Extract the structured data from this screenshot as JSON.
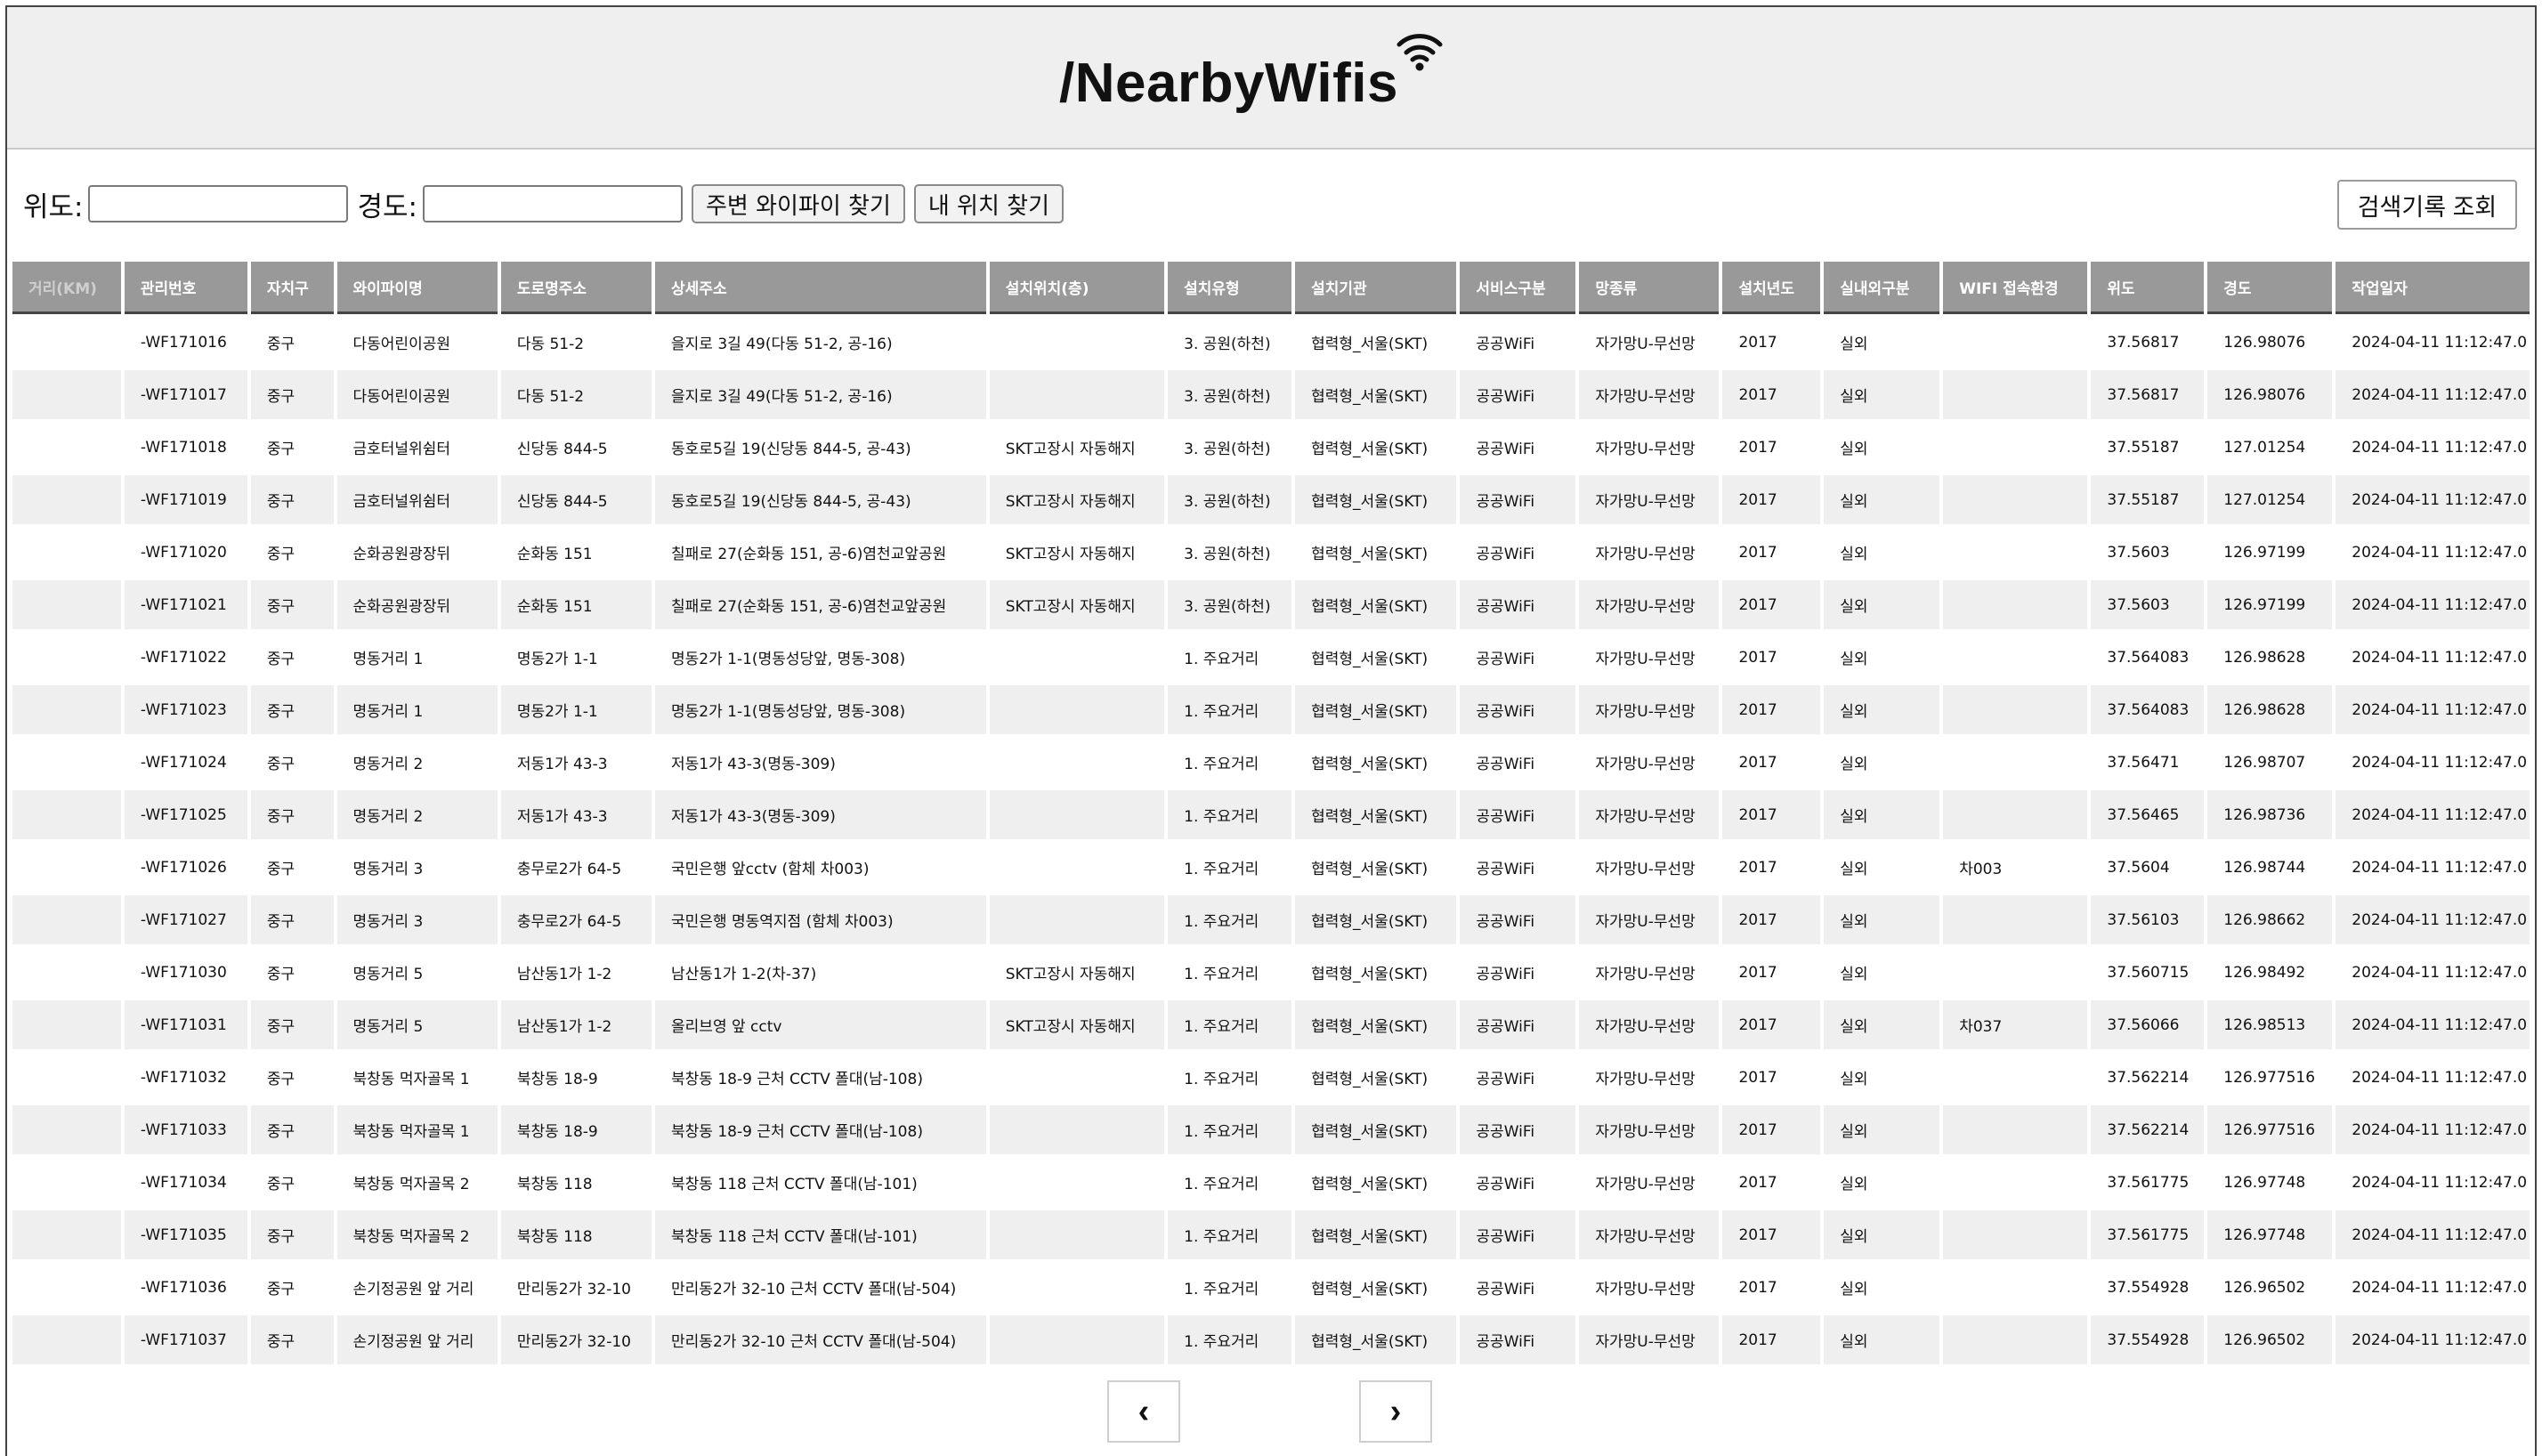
{
  "app": {
    "title": "/NearbyWifis"
  },
  "controls": {
    "lat_label": "위도:",
    "lng_label": "경도:",
    "lat_value": "",
    "lng_value": "",
    "find_nearby_label": "주변 와이파이 찾기",
    "my_location_label": "내 위치 찾기",
    "history_label": "검색기록 조회"
  },
  "table": {
    "columns": [
      "거리(KM)",
      "관리번호",
      "자치구",
      "와이파이명",
      "도로명주소",
      "상세주소",
      "설치위치(층)",
      "설치유형",
      "설치기관",
      "서비스구분",
      "망종류",
      "설치년도",
      "실내외구분",
      "WIFI 접속환경",
      "위도",
      "경도",
      "작업일자"
    ],
    "rows": [
      [
        "",
        "-WF171016",
        "중구",
        "다동어린이공원",
        "다동 51-2",
        "을지로 3길 49(다동 51-2, 공-16)",
        "",
        "3. 공원(하천)",
        "협력형_서울(SKT)",
        "공공WiFi",
        "자가망U-무선망",
        "2017",
        "실외",
        "",
        "37.56817",
        "126.98076",
        "2024-04-11 11:12:47.0"
      ],
      [
        "",
        "-WF171017",
        "중구",
        "다동어린이공원",
        "다동 51-2",
        "을지로 3길 49(다동 51-2, 공-16)",
        "",
        "3. 공원(하천)",
        "협력형_서울(SKT)",
        "공공WiFi",
        "자가망U-무선망",
        "2017",
        "실외",
        "",
        "37.56817",
        "126.98076",
        "2024-04-11 11:12:47.0"
      ],
      [
        "",
        "-WF171018",
        "중구",
        "금호터널위쉼터",
        "신당동 844-5",
        "동호로5길 19(신당동 844-5, 공-43)",
        "SKT고장시 자동해지",
        "3. 공원(하천)",
        "협력형_서울(SKT)",
        "공공WiFi",
        "자가망U-무선망",
        "2017",
        "실외",
        "",
        "37.55187",
        "127.01254",
        "2024-04-11 11:12:47.0"
      ],
      [
        "",
        "-WF171019",
        "중구",
        "금호터널위쉼터",
        "신당동 844-5",
        "동호로5길 19(신당동 844-5, 공-43)",
        "SKT고장시 자동해지",
        "3. 공원(하천)",
        "협력형_서울(SKT)",
        "공공WiFi",
        "자가망U-무선망",
        "2017",
        "실외",
        "",
        "37.55187",
        "127.01254",
        "2024-04-11 11:12:47.0"
      ],
      [
        "",
        "-WF171020",
        "중구",
        "순화공원광장뒤",
        "순화동 151",
        "칠패로 27(순화동 151, 공-6)염천교앞공원",
        "SKT고장시 자동해지",
        "3. 공원(하천)",
        "협력형_서울(SKT)",
        "공공WiFi",
        "자가망U-무선망",
        "2017",
        "실외",
        "",
        "37.5603",
        "126.97199",
        "2024-04-11 11:12:47.0"
      ],
      [
        "",
        "-WF171021",
        "중구",
        "순화공원광장뒤",
        "순화동 151",
        "칠패로 27(순화동 151, 공-6)염천교앞공원",
        "SKT고장시 자동해지",
        "3. 공원(하천)",
        "협력형_서울(SKT)",
        "공공WiFi",
        "자가망U-무선망",
        "2017",
        "실외",
        "",
        "37.5603",
        "126.97199",
        "2024-04-11 11:12:47.0"
      ],
      [
        "",
        "-WF171022",
        "중구",
        "명동거리 1",
        "명동2가 1-1",
        "명동2가 1-1(명동성당앞, 명동-308)",
        "",
        "1. 주요거리",
        "협력형_서울(SKT)",
        "공공WiFi",
        "자가망U-무선망",
        "2017",
        "실외",
        "",
        "37.564083",
        "126.98628",
        "2024-04-11 11:12:47.0"
      ],
      [
        "",
        "-WF171023",
        "중구",
        "명동거리 1",
        "명동2가 1-1",
        "명동2가 1-1(명동성당앞, 명동-308)",
        "",
        "1. 주요거리",
        "협력형_서울(SKT)",
        "공공WiFi",
        "자가망U-무선망",
        "2017",
        "실외",
        "",
        "37.564083",
        "126.98628",
        "2024-04-11 11:12:47.0"
      ],
      [
        "",
        "-WF171024",
        "중구",
        "명동거리 2",
        "저동1가 43-3",
        "저동1가 43-3(명동-309)",
        "",
        "1. 주요거리",
        "협력형_서울(SKT)",
        "공공WiFi",
        "자가망U-무선망",
        "2017",
        "실외",
        "",
        "37.56471",
        "126.98707",
        "2024-04-11 11:12:47.0"
      ],
      [
        "",
        "-WF171025",
        "중구",
        "명동거리 2",
        "저동1가 43-3",
        "저동1가 43-3(명동-309)",
        "",
        "1. 주요거리",
        "협력형_서울(SKT)",
        "공공WiFi",
        "자가망U-무선망",
        "2017",
        "실외",
        "",
        "37.56465",
        "126.98736",
        "2024-04-11 11:12:47.0"
      ],
      [
        "",
        "-WF171026",
        "중구",
        "명동거리 3",
        "충무로2가 64-5",
        "국민은행 앞cctv (함체 차003)",
        "",
        "1. 주요거리",
        "협력형_서울(SKT)",
        "공공WiFi",
        "자가망U-무선망",
        "2017",
        "실외",
        "차003",
        "37.5604",
        "126.98744",
        "2024-04-11 11:12:47.0"
      ],
      [
        "",
        "-WF171027",
        "중구",
        "명동거리 3",
        "충무로2가 64-5",
        "국민은행 명동역지점 (함체 차003)",
        "",
        "1. 주요거리",
        "협력형_서울(SKT)",
        "공공WiFi",
        "자가망U-무선망",
        "2017",
        "실외",
        "",
        "37.56103",
        "126.98662",
        "2024-04-11 11:12:47.0"
      ],
      [
        "",
        "-WF171030",
        "중구",
        "명동거리 5",
        "남산동1가 1-2",
        "남산동1가 1-2(차-37)",
        "SKT고장시 자동해지",
        "1. 주요거리",
        "협력형_서울(SKT)",
        "공공WiFi",
        "자가망U-무선망",
        "2017",
        "실외",
        "",
        "37.560715",
        "126.98492",
        "2024-04-11 11:12:47.0"
      ],
      [
        "",
        "-WF171031",
        "중구",
        "명동거리 5",
        "남산동1가 1-2",
        "올리브영 앞 cctv",
        "SKT고장시 자동해지",
        "1. 주요거리",
        "협력형_서울(SKT)",
        "공공WiFi",
        "자가망U-무선망",
        "2017",
        "실외",
        "차037",
        "37.56066",
        "126.98513",
        "2024-04-11 11:12:47.0"
      ],
      [
        "",
        "-WF171032",
        "중구",
        "북창동 먹자골목 1",
        "북창동 18-9",
        "북창동 18-9 근처 CCTV 폴대(남-108)",
        "",
        "1. 주요거리",
        "협력형_서울(SKT)",
        "공공WiFi",
        "자가망U-무선망",
        "2017",
        "실외",
        "",
        "37.562214",
        "126.977516",
        "2024-04-11 11:12:47.0"
      ],
      [
        "",
        "-WF171033",
        "중구",
        "북창동 먹자골목 1",
        "북창동 18-9",
        "북창동 18-9 근처 CCTV 폴대(남-108)",
        "",
        "1. 주요거리",
        "협력형_서울(SKT)",
        "공공WiFi",
        "자가망U-무선망",
        "2017",
        "실외",
        "",
        "37.562214",
        "126.977516",
        "2024-04-11 11:12:47.0"
      ],
      [
        "",
        "-WF171034",
        "중구",
        "북창동 먹자골목 2",
        "북창동 118",
        "북창동 118 근처 CCTV 폴대(남-101)",
        "",
        "1. 주요거리",
        "협력형_서울(SKT)",
        "공공WiFi",
        "자가망U-무선망",
        "2017",
        "실외",
        "",
        "37.561775",
        "126.97748",
        "2024-04-11 11:12:47.0"
      ],
      [
        "",
        "-WF171035",
        "중구",
        "북창동 먹자골목 2",
        "북창동 118",
        "북창동 118 근처 CCTV 폴대(남-101)",
        "",
        "1. 주요거리",
        "협력형_서울(SKT)",
        "공공WiFi",
        "자가망U-무선망",
        "2017",
        "실외",
        "",
        "37.561775",
        "126.97748",
        "2024-04-11 11:12:47.0"
      ],
      [
        "",
        "-WF171036",
        "중구",
        "손기정공원 앞 거리",
        "만리동2가 32-10",
        "만리동2가 32-10 근처 CCTV 폴대(남-504)",
        "",
        "1. 주요거리",
        "협력형_서울(SKT)",
        "공공WiFi",
        "자가망U-무선망",
        "2017",
        "실외",
        "",
        "37.554928",
        "126.96502",
        "2024-04-11 11:12:47.0"
      ],
      [
        "",
        "-WF171037",
        "중구",
        "손기정공원 앞 거리",
        "만리동2가 32-10",
        "만리동2가 32-10 근처 CCTV 폴대(남-504)",
        "",
        "1. 주요거리",
        "협력형_서울(SKT)",
        "공공WiFi",
        "자가망U-무선망",
        "2017",
        "실외",
        "",
        "37.554928",
        "126.96502",
        "2024-04-11 11:12:47.0"
      ]
    ]
  },
  "pagination": {
    "prev_label": "‹",
    "next_label": "›"
  }
}
